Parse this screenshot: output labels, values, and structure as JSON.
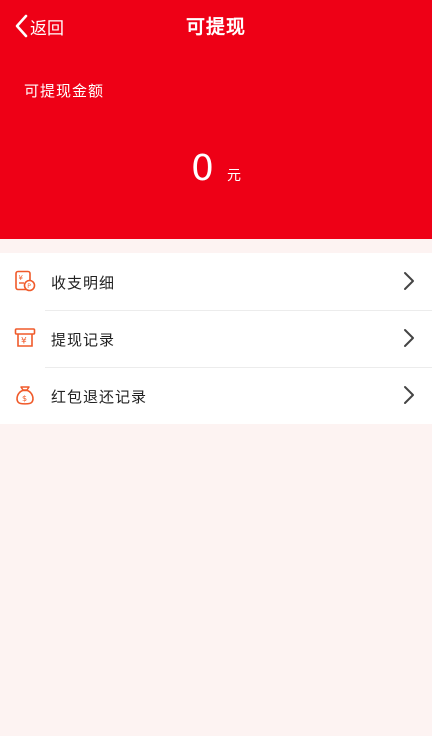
{
  "nav": {
    "back_label": "返回",
    "title": "可提现"
  },
  "balance": {
    "label": "可提现金额",
    "amount": "0",
    "unit": "元"
  },
  "menu": {
    "items": [
      {
        "label": "收支明细",
        "icon": "ledger-icon"
      },
      {
        "label": "提现记录",
        "icon": "withdraw-record-icon"
      },
      {
        "label": "红包退还记录",
        "icon": "money-bag-icon"
      }
    ]
  },
  "colors": {
    "brand_red": "#ee0016",
    "icon_orange": "#f05a2a",
    "background": "#fdf3f2"
  }
}
